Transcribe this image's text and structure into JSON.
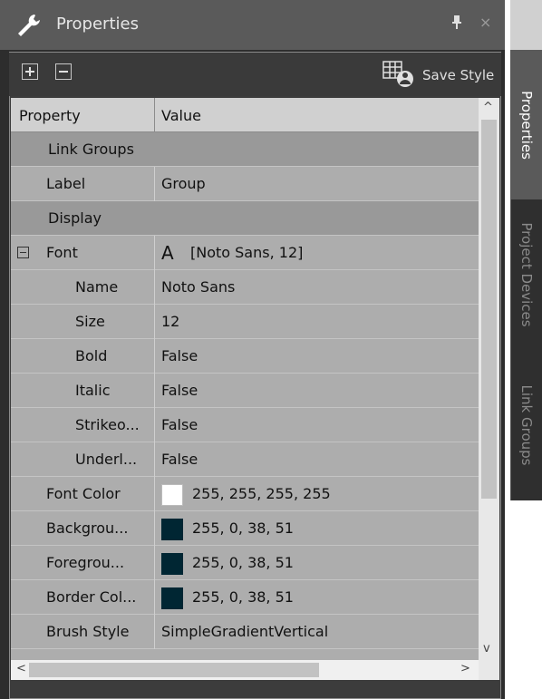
{
  "window": {
    "title": "Properties",
    "pin_glyph": "📌",
    "close_glyph": "×"
  },
  "toolbar": {
    "expand_icon": "plus-box-icon",
    "collapse_icon": "minus-box-icon",
    "save_style_label": "Save Style"
  },
  "grid": {
    "columns": {
      "property": "Property",
      "value": "Value"
    },
    "rows": [
      {
        "kind": "category",
        "name": "Link Groups"
      },
      {
        "kind": "prop",
        "name": "Label",
        "value": "Group"
      },
      {
        "kind": "category",
        "name": "Display"
      },
      {
        "kind": "prop",
        "name": "Font",
        "value": "[Noto Sans, 12]",
        "font_glyph": "A",
        "expander": "⊟"
      },
      {
        "kind": "sub",
        "name": "Name",
        "value": "Noto Sans"
      },
      {
        "kind": "sub",
        "name": "Size",
        "value": "12"
      },
      {
        "kind": "sub",
        "name": "Bold",
        "value": "False"
      },
      {
        "kind": "sub",
        "name": "Italic",
        "value": "False"
      },
      {
        "kind": "sub",
        "name": "Strikeo...",
        "value": "False"
      },
      {
        "kind": "sub",
        "name": "Underl...",
        "value": "False"
      },
      {
        "kind": "prop",
        "name": "Font Color",
        "value": "255, 255, 255, 255",
        "swatch": "#ffffff"
      },
      {
        "kind": "prop",
        "name": "Backgrou...",
        "value": "255, 0, 38, 51",
        "swatch": "#002633"
      },
      {
        "kind": "prop",
        "name": "Foregrou...",
        "value": "255, 0, 38, 51",
        "swatch": "#002633"
      },
      {
        "kind": "prop",
        "name": "Border Col...",
        "value": "255, 0, 38, 51",
        "swatch": "#002633"
      },
      {
        "kind": "prop",
        "name": "Brush Style",
        "value": "SimpleGradientVertical"
      }
    ]
  },
  "scroll": {
    "up": "^",
    "down": "v",
    "left": "<",
    "right": ">"
  },
  "side_tabs": [
    {
      "label": "Properties",
      "active": true
    },
    {
      "label": "Project Devices",
      "active": false
    },
    {
      "label": "Link Groups",
      "active": false
    }
  ],
  "colors": {
    "dark_swatch": "#002633",
    "active_tab": "#5a5a5a",
    "category_row": "#999999"
  }
}
